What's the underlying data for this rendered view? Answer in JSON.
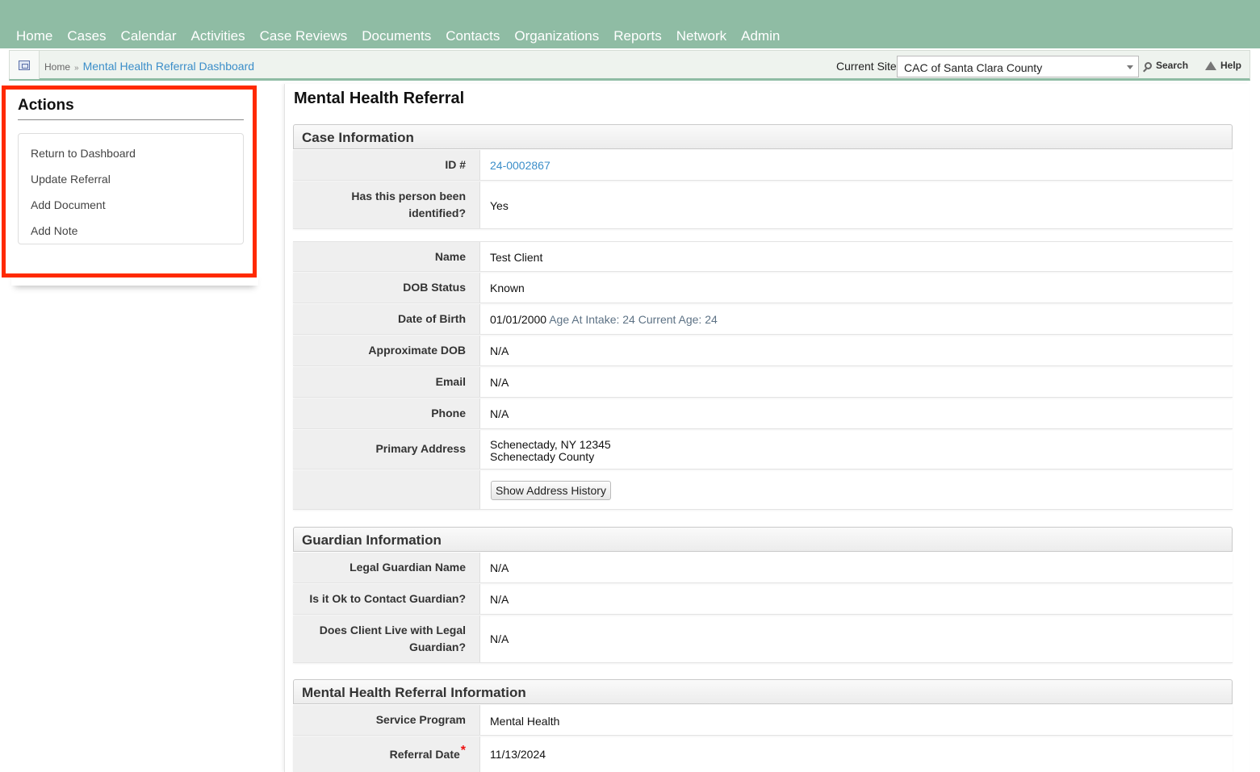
{
  "nav": {
    "items": [
      "Home",
      "Cases",
      "Calendar",
      "Activities",
      "Case Reviews",
      "Documents",
      "Contacts",
      "Organizations",
      "Reports",
      "Network",
      "Admin"
    ]
  },
  "breadcrumb": {
    "home": "Home",
    "separator": "»",
    "current": "Mental Health Referral Dashboard"
  },
  "site": {
    "label": "Current Site",
    "selected": "CAC of Santa Clara County"
  },
  "utility": {
    "search": "Search",
    "help": "Help"
  },
  "actions": {
    "title": "Actions",
    "items": [
      "Return to Dashboard",
      "Update Referral",
      "Add Document",
      "Add Note"
    ]
  },
  "page": {
    "title": "Mental Health Referral"
  },
  "case_info": {
    "heading": "Case Information",
    "id_label": "ID #",
    "id_value": "24-0002867",
    "identified_label": "Has this person been identified?",
    "identified_value": "Yes",
    "name_label": "Name",
    "name_value": "Test Client",
    "dob_status_label": "DOB Status",
    "dob_status_value": "Known",
    "dob_label": "Date of Birth",
    "dob_value": "01/01/2000",
    "age_info": "Age At Intake: 24 Current Age: 24",
    "approx_dob_label": "Approximate DOB",
    "approx_dob_value": "N/A",
    "email_label": "Email",
    "email_value": "N/A",
    "phone_label": "Phone",
    "phone_value": "N/A",
    "address_label": "Primary Address",
    "address_line1": "Schenectady, NY 12345",
    "address_line2": "Schenectady County",
    "address_history_button": "Show Address History"
  },
  "guardian_info": {
    "heading": "Guardian Information",
    "name_label": "Legal Guardian Name",
    "name_value": "N/A",
    "contact_label": "Is it Ok to Contact Guardian?",
    "contact_value": "N/A",
    "lives_label": "Does Client Live with Legal Guardian?",
    "lives_value": "N/A"
  },
  "referral_info": {
    "heading": "Mental Health Referral Information",
    "program_label": "Service Program",
    "program_value": "Mental Health",
    "date_label": "Referral Date",
    "required_mark": "*",
    "date_value": "11/13/2024"
  },
  "colors": {
    "nav_bg": "#8fbca4",
    "link": "#3b8ec9",
    "highlight": "#ff2a00"
  }
}
